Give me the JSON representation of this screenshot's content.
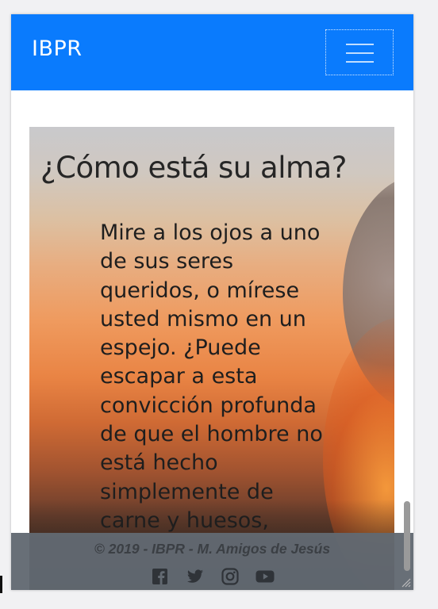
{
  "navbar": {
    "brand": "IBPR",
    "menu_icon": "hamburger-menu-icon",
    "color": "#0a7bfd"
  },
  "hero": {
    "title": "¿Cómo está su alma?",
    "text": "Mire a los ojos a uno de sus seres queridos, o mírese usted mismo en un espejo. ¿Puede escapar a esta convicción profunda de que el hombre no está hecho simplemente de carne y huesos,"
  },
  "footer": {
    "copyright": "© 2019 - IBPR - M. Amigos de Jesús",
    "social": [
      "facebook-icon",
      "twitter-icon",
      "instagram-icon",
      "youtube-icon"
    ],
    "color": "#626971"
  }
}
